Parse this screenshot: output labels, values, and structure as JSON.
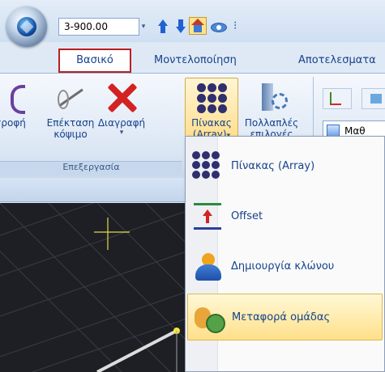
{
  "quick_access": {
    "value": "3-900.00",
    "dropdown_glyph": "▾",
    "more_glyph": "⁝",
    "icons": [
      "app-orb-icon",
      "up-arrow-icon",
      "down-arrow-icon",
      "house-icon",
      "eye-icon"
    ]
  },
  "tabs": [
    {
      "label": "Βασικό",
      "active": true
    },
    {
      "label": "Μοντελοποίηση",
      "active": false
    },
    {
      "label": "Αποτελεσματα",
      "active": false
    }
  ],
  "ribbon": {
    "group_caption": "Επεξεργασία",
    "buttons": [
      {
        "label": "τροφή",
        "icon": "trim-icon"
      },
      {
        "label": "Επέκταση",
        "label2": "κόψιμο",
        "icon": "extend-icon"
      },
      {
        "label": "Διαγραφή",
        "sub": "▾",
        "icon": "delete-icon"
      },
      {
        "label": "Πίνακας",
        "label2": "(Array)",
        "sub": "▾",
        "icon": "array-icon"
      },
      {
        "label": "Πολλαπλές",
        "label2": "επιλογές",
        "icon": "multi-select-icon"
      }
    ],
    "combo_value": "Μαθ",
    "axis_dropdown_glyph": "▾"
  },
  "menu": {
    "items": [
      {
        "label": "Πίνακας (Array)",
        "icon": "array-icon"
      },
      {
        "label": "Offset",
        "icon": "offset-icon"
      },
      {
        "label": "Δημιουργία κλώνου",
        "icon": "clone-icon"
      },
      {
        "label": "Μεταφορά ομάδας",
        "icon": "group-move-icon",
        "highlighted": true
      }
    ]
  },
  "colors": {
    "active_tab_border": "#b82020",
    "ribbon_text": "#15428b",
    "canvas": "#1d1f24",
    "highlight": "#ffe08a"
  }
}
